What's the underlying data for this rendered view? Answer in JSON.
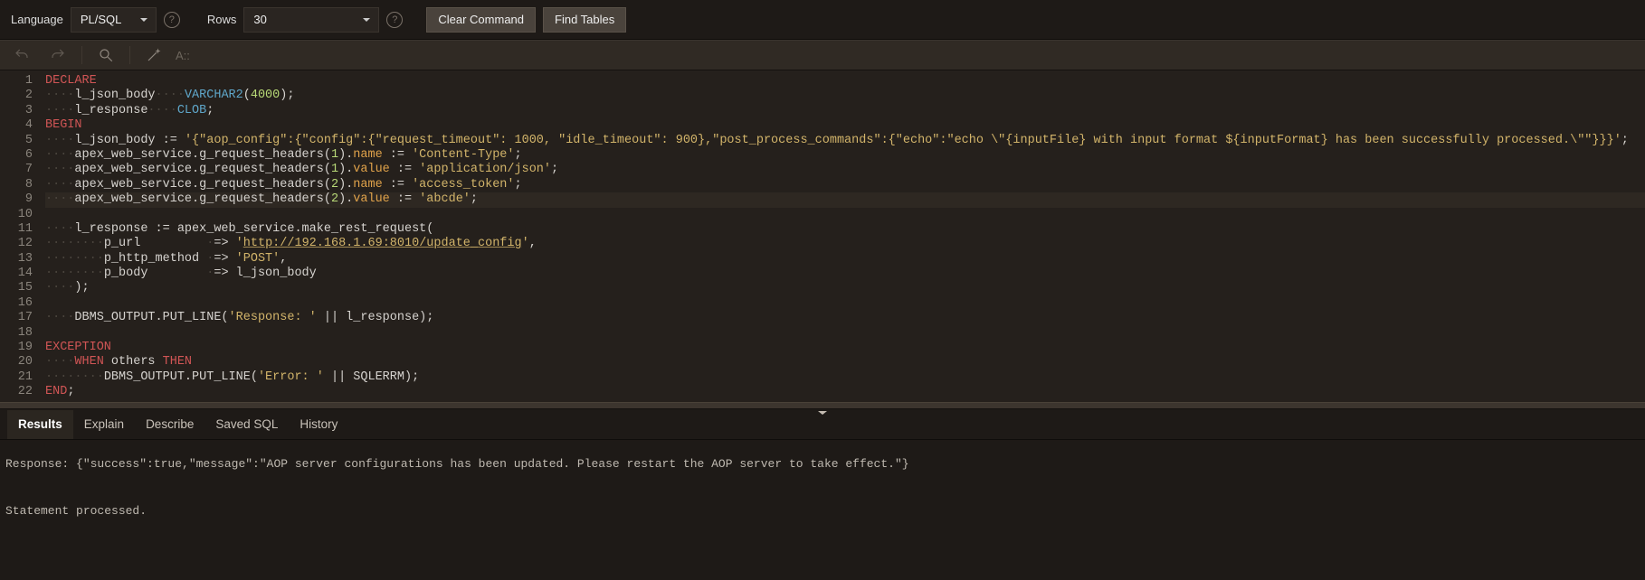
{
  "toolbar": {
    "language_label": "Language",
    "language_value": "PL/SQL",
    "rows_label": "Rows",
    "rows_value": "30",
    "clear_label": "Clear Command",
    "find_label": "Find Tables",
    "hint_placeholder": "A::"
  },
  "code": {
    "lines": [
      [
        {
          "t": "DECLARE",
          "c": "kw-red"
        }
      ],
      [
        {
          "t": "····",
          "c": "ws"
        },
        {
          "t": "l_json_body",
          "c": "op"
        },
        {
          "t": "····",
          "c": "ws"
        },
        {
          "t": "VARCHAR2",
          "c": "fn-blue"
        },
        {
          "t": "(",
          "c": "op"
        },
        {
          "t": "4000",
          "c": "num"
        },
        {
          "t": ");",
          "c": "op"
        }
      ],
      [
        {
          "t": "····",
          "c": "ws"
        },
        {
          "t": "l_response",
          "c": "op"
        },
        {
          "t": "····",
          "c": "ws"
        },
        {
          "t": "CLOB",
          "c": "fn-blue"
        },
        {
          "t": ";",
          "c": "op"
        }
      ],
      [
        {
          "t": "BEGIN",
          "c": "kw-red"
        }
      ],
      [
        {
          "t": "····",
          "c": "ws"
        },
        {
          "t": "l_json_body := ",
          "c": "op"
        },
        {
          "t": "'{\"aop_config\":{\"config\":{\"request_timeout\": 1000, \"idle_timeout\": 900},\"post_process_commands\":{\"echo\":\"echo \\\"{inputFile} with input format ${inputFormat} has been successfully processed.\\\"\"}}}'",
          "c": "str"
        },
        {
          "t": ";",
          "c": "op"
        }
      ],
      [
        {
          "t": "····",
          "c": "ws"
        },
        {
          "t": "apex_web_service.g_request_headers(",
          "c": "op"
        },
        {
          "t": "1",
          "c": "num"
        },
        {
          "t": ").",
          "c": "op"
        },
        {
          "t": "name",
          "c": "kw-orange"
        },
        {
          "t": " := ",
          "c": "op"
        },
        {
          "t": "'Content-Type'",
          "c": "str"
        },
        {
          "t": ";",
          "c": "op"
        }
      ],
      [
        {
          "t": "····",
          "c": "ws"
        },
        {
          "t": "apex_web_service.g_request_headers(",
          "c": "op"
        },
        {
          "t": "1",
          "c": "num"
        },
        {
          "t": ").",
          "c": "op"
        },
        {
          "t": "value",
          "c": "kw-orange"
        },
        {
          "t": " := ",
          "c": "op"
        },
        {
          "t": "'application/json'",
          "c": "str"
        },
        {
          "t": ";",
          "c": "op"
        }
      ],
      [
        {
          "t": "····",
          "c": "ws"
        },
        {
          "t": "apex_web_service.g_request_headers(",
          "c": "op"
        },
        {
          "t": "2",
          "c": "num"
        },
        {
          "t": ").",
          "c": "op"
        },
        {
          "t": "name",
          "c": "kw-orange"
        },
        {
          "t": " := ",
          "c": "op"
        },
        {
          "t": "'access_token'",
          "c": "str"
        },
        {
          "t": ";",
          "c": "op"
        }
      ],
      [
        {
          "t": "····",
          "c": "ws"
        },
        {
          "t": "apex_web_service.g_request_headers(",
          "c": "op"
        },
        {
          "t": "2",
          "c": "num"
        },
        {
          "t": ").",
          "c": "op"
        },
        {
          "t": "value",
          "c": "kw-orange"
        },
        {
          "t": " := ",
          "c": "op"
        },
        {
          "t": "'abcde'",
          "c": "str"
        },
        {
          "t": ";",
          "c": "op"
        }
      ],
      [],
      [
        {
          "t": "····",
          "c": "ws"
        },
        {
          "t": "l_response := apex_web_service.make_rest_request(",
          "c": "op"
        }
      ],
      [
        {
          "t": "········",
          "c": "ws"
        },
        {
          "t": "p_url         ",
          "c": "op"
        },
        {
          "t": "·",
          "c": "ws"
        },
        {
          "t": "=> ",
          "c": "op"
        },
        {
          "t": "'",
          "c": "str"
        },
        {
          "t": "http://192.168.1.69:8010/update_config",
          "c": "url"
        },
        {
          "t": "'",
          "c": "str"
        },
        {
          "t": ",",
          "c": "op"
        }
      ],
      [
        {
          "t": "········",
          "c": "ws"
        },
        {
          "t": "p_http_method ",
          "c": "op"
        },
        {
          "t": "·",
          "c": "ws"
        },
        {
          "t": "=> ",
          "c": "op"
        },
        {
          "t": "'POST'",
          "c": "str"
        },
        {
          "t": ",",
          "c": "op"
        }
      ],
      [
        {
          "t": "········",
          "c": "ws"
        },
        {
          "t": "p_body        ",
          "c": "op"
        },
        {
          "t": "·",
          "c": "ws"
        },
        {
          "t": "=> l_json_body",
          "c": "op"
        }
      ],
      [
        {
          "t": "····",
          "c": "ws"
        },
        {
          "t": ");",
          "c": "op"
        }
      ],
      [],
      [
        {
          "t": "····",
          "c": "ws"
        },
        {
          "t": "DBMS_OUTPUT.PUT_LINE(",
          "c": "op"
        },
        {
          "t": "'Response: '",
          "c": "str"
        },
        {
          "t": " || l_response);",
          "c": "op"
        }
      ],
      [],
      [
        {
          "t": "EXCEPTION",
          "c": "kw-red"
        }
      ],
      [
        {
          "t": "····",
          "c": "ws"
        },
        {
          "t": "WHEN",
          "c": "kw-red"
        },
        {
          "t": " others ",
          "c": "op"
        },
        {
          "t": "THEN",
          "c": "kw-red"
        }
      ],
      [
        {
          "t": "········",
          "c": "ws"
        },
        {
          "t": "DBMS_OUTPUT.PUT_LINE(",
          "c": "op"
        },
        {
          "t": "'Error: '",
          "c": "str"
        },
        {
          "t": " || SQLERRM);",
          "c": "op"
        }
      ],
      [
        {
          "t": "END",
          "c": "kw-red"
        },
        {
          "t": ";",
          "c": "op"
        }
      ]
    ],
    "highlight_line": 9
  },
  "tabs": {
    "items": [
      "Results",
      "Explain",
      "Describe",
      "Saved SQL",
      "History"
    ],
    "active_index": 0
  },
  "output": {
    "line1": "Response: {\"success\":true,\"message\":\"AOP server configurations has been updated. Please restart the AOP server to take effect.\"}",
    "line2": "Statement processed."
  }
}
